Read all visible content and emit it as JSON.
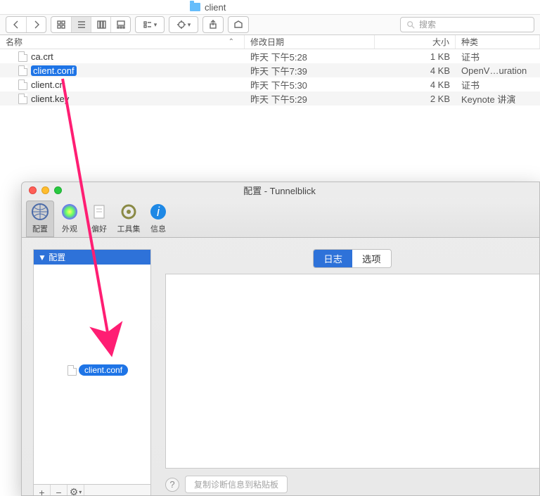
{
  "finder": {
    "title": "client",
    "search_placeholder": "搜索",
    "columns": {
      "name": "名称",
      "date": "修改日期",
      "size": "大小",
      "kind": "种类"
    },
    "rows": [
      {
        "name": "ca.crt",
        "date": "昨天 下午5:28",
        "size": "1 KB",
        "kind": "证书",
        "selected": false
      },
      {
        "name": "client.conf",
        "date": "昨天 下午7:39",
        "size": "4 KB",
        "kind": "OpenV…uration",
        "selected": true
      },
      {
        "name": "client.crt",
        "date": "昨天 下午5:30",
        "size": "4 KB",
        "kind": "证书",
        "selected": false
      },
      {
        "name": "client.key",
        "date": "昨天 下午5:29",
        "size": "2 KB",
        "kind": "Keynote 讲演",
        "selected": false
      }
    ]
  },
  "tunnelblick": {
    "title": "配置 - Tunnelblick",
    "tabs": [
      {
        "id": "config",
        "label": "配置",
        "selected": true
      },
      {
        "id": "appear",
        "label": "外观",
        "selected": false
      },
      {
        "id": "prefer",
        "label": "偏好",
        "selected": false
      },
      {
        "id": "tools",
        "label": "工具集",
        "selected": false
      },
      {
        "id": "info",
        "label": "信息",
        "selected": false
      }
    ],
    "sidebar_head": "▼ 配置",
    "drag_file": "client.conf",
    "segments": {
      "log": "日志",
      "options": "选项"
    },
    "copy_button": "复制诊断信息到粘贴板",
    "side_buttons": {
      "add": "+",
      "remove": "−",
      "gear": "⚙",
      "caret": "▾"
    }
  }
}
